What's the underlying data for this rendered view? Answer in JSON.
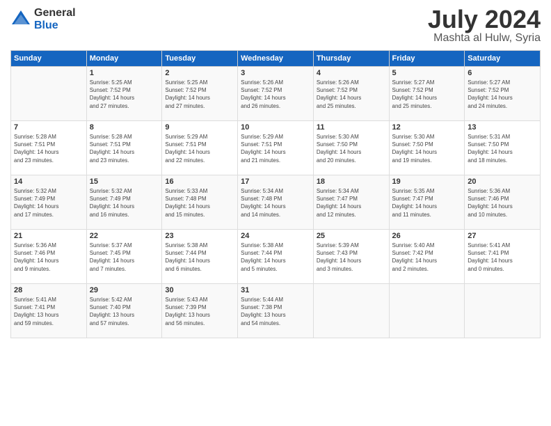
{
  "header": {
    "logo_general": "General",
    "logo_blue": "Blue",
    "month_title": "July 2024",
    "subtitle": "Mashta al Hulw, Syria"
  },
  "weekdays": [
    "Sunday",
    "Monday",
    "Tuesday",
    "Wednesday",
    "Thursday",
    "Friday",
    "Saturday"
  ],
  "weeks": [
    [
      {
        "day": "",
        "content": ""
      },
      {
        "day": "1",
        "content": "Sunrise: 5:25 AM\nSunset: 7:52 PM\nDaylight: 14 hours\nand 27 minutes."
      },
      {
        "day": "2",
        "content": "Sunrise: 5:25 AM\nSunset: 7:52 PM\nDaylight: 14 hours\nand 27 minutes."
      },
      {
        "day": "3",
        "content": "Sunrise: 5:26 AM\nSunset: 7:52 PM\nDaylight: 14 hours\nand 26 minutes."
      },
      {
        "day": "4",
        "content": "Sunrise: 5:26 AM\nSunset: 7:52 PM\nDaylight: 14 hours\nand 25 minutes."
      },
      {
        "day": "5",
        "content": "Sunrise: 5:27 AM\nSunset: 7:52 PM\nDaylight: 14 hours\nand 25 minutes."
      },
      {
        "day": "6",
        "content": "Sunrise: 5:27 AM\nSunset: 7:52 PM\nDaylight: 14 hours\nand 24 minutes."
      }
    ],
    [
      {
        "day": "7",
        "content": "Sunrise: 5:28 AM\nSunset: 7:51 PM\nDaylight: 14 hours\nand 23 minutes."
      },
      {
        "day": "8",
        "content": "Sunrise: 5:28 AM\nSunset: 7:51 PM\nDaylight: 14 hours\nand 23 minutes."
      },
      {
        "day": "9",
        "content": "Sunrise: 5:29 AM\nSunset: 7:51 PM\nDaylight: 14 hours\nand 22 minutes."
      },
      {
        "day": "10",
        "content": "Sunrise: 5:29 AM\nSunset: 7:51 PM\nDaylight: 14 hours\nand 21 minutes."
      },
      {
        "day": "11",
        "content": "Sunrise: 5:30 AM\nSunset: 7:50 PM\nDaylight: 14 hours\nand 20 minutes."
      },
      {
        "day": "12",
        "content": "Sunrise: 5:30 AM\nSunset: 7:50 PM\nDaylight: 14 hours\nand 19 minutes."
      },
      {
        "day": "13",
        "content": "Sunrise: 5:31 AM\nSunset: 7:50 PM\nDaylight: 14 hours\nand 18 minutes."
      }
    ],
    [
      {
        "day": "14",
        "content": "Sunrise: 5:32 AM\nSunset: 7:49 PM\nDaylight: 14 hours\nand 17 minutes."
      },
      {
        "day": "15",
        "content": "Sunrise: 5:32 AM\nSunset: 7:49 PM\nDaylight: 14 hours\nand 16 minutes."
      },
      {
        "day": "16",
        "content": "Sunrise: 5:33 AM\nSunset: 7:48 PM\nDaylight: 14 hours\nand 15 minutes."
      },
      {
        "day": "17",
        "content": "Sunrise: 5:34 AM\nSunset: 7:48 PM\nDaylight: 14 hours\nand 14 minutes."
      },
      {
        "day": "18",
        "content": "Sunrise: 5:34 AM\nSunset: 7:47 PM\nDaylight: 14 hours\nand 12 minutes."
      },
      {
        "day": "19",
        "content": "Sunrise: 5:35 AM\nSunset: 7:47 PM\nDaylight: 14 hours\nand 11 minutes."
      },
      {
        "day": "20",
        "content": "Sunrise: 5:36 AM\nSunset: 7:46 PM\nDaylight: 14 hours\nand 10 minutes."
      }
    ],
    [
      {
        "day": "21",
        "content": "Sunrise: 5:36 AM\nSunset: 7:46 PM\nDaylight: 14 hours\nand 9 minutes."
      },
      {
        "day": "22",
        "content": "Sunrise: 5:37 AM\nSunset: 7:45 PM\nDaylight: 14 hours\nand 7 minutes."
      },
      {
        "day": "23",
        "content": "Sunrise: 5:38 AM\nSunset: 7:44 PM\nDaylight: 14 hours\nand 6 minutes."
      },
      {
        "day": "24",
        "content": "Sunrise: 5:38 AM\nSunset: 7:44 PM\nDaylight: 14 hours\nand 5 minutes."
      },
      {
        "day": "25",
        "content": "Sunrise: 5:39 AM\nSunset: 7:43 PM\nDaylight: 14 hours\nand 3 minutes."
      },
      {
        "day": "26",
        "content": "Sunrise: 5:40 AM\nSunset: 7:42 PM\nDaylight: 14 hours\nand 2 minutes."
      },
      {
        "day": "27",
        "content": "Sunrise: 5:41 AM\nSunset: 7:41 PM\nDaylight: 14 hours\nand 0 minutes."
      }
    ],
    [
      {
        "day": "28",
        "content": "Sunrise: 5:41 AM\nSunset: 7:41 PM\nDaylight: 13 hours\nand 59 minutes."
      },
      {
        "day": "29",
        "content": "Sunrise: 5:42 AM\nSunset: 7:40 PM\nDaylight: 13 hours\nand 57 minutes."
      },
      {
        "day": "30",
        "content": "Sunrise: 5:43 AM\nSunset: 7:39 PM\nDaylight: 13 hours\nand 56 minutes."
      },
      {
        "day": "31",
        "content": "Sunrise: 5:44 AM\nSunset: 7:38 PM\nDaylight: 13 hours\nand 54 minutes."
      },
      {
        "day": "",
        "content": ""
      },
      {
        "day": "",
        "content": ""
      },
      {
        "day": "",
        "content": ""
      }
    ]
  ]
}
